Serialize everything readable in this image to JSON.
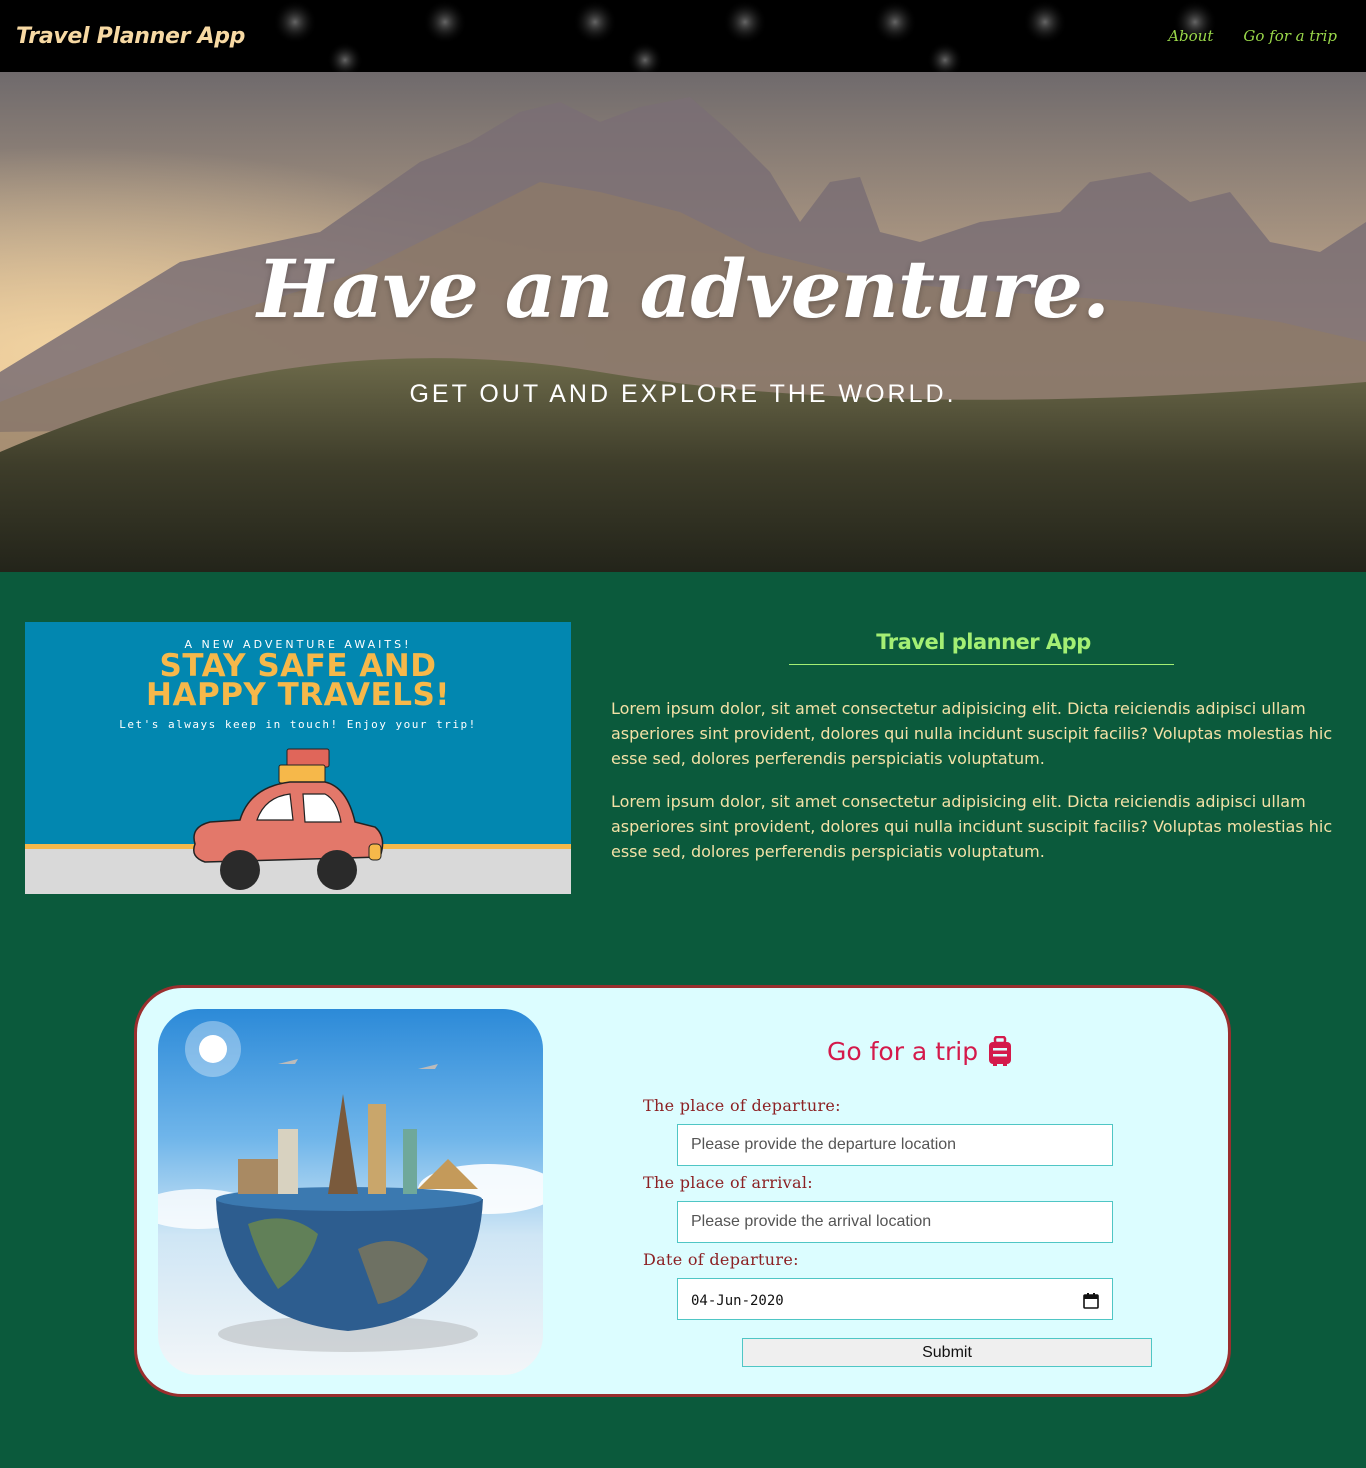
{
  "nav": {
    "brand": "Travel Planner App",
    "links": [
      "About",
      "Go for a trip"
    ]
  },
  "hero": {
    "title": "Have an adventure.",
    "subtitle": "GET OUT AND EXPLORE THE WORLD."
  },
  "about": {
    "image": {
      "kicker": "A NEW ADVENTURE AWAITS!",
      "headline_1": "STAY SAFE AND",
      "headline_2": "HAPPY TRAVELS!",
      "tagline": "Let's always keep in touch! Enjoy your trip!"
    },
    "title": "Travel planner App",
    "paragraphs": [
      "Lorem ipsum dolor, sit amet consectetur adipisicing elit. Dicta reiciendis adipisci ullam asperiores sint provident, dolores qui nulla incidunt suscipit facilis? Voluptas molestias hic esse sed, dolores perferendis perspiciatis voluptatum.",
      "Lorem ipsum dolor, sit amet consectetur adipisicing elit. Dicta reiciendis adipisci ullam asperiores sint provident, dolores qui nulla incidunt suscipit facilis? Voluptas molestias hic esse sed, dolores perferendis perspiciatis voluptatum."
    ]
  },
  "trip": {
    "title": "Go for a trip",
    "title_icon": "suitcase-icon",
    "departure_label": "The place of departure:",
    "departure_placeholder": "Please provide the departure location",
    "arrival_label": "The place of arrival:",
    "arrival_placeholder": "Please provide the arrival location",
    "date_label": "Date of departure:",
    "date_value": "04-Jun-2020",
    "submit_label": "Submit"
  },
  "colors": {
    "nav_bg": "#000000",
    "brand": "#f7d9a3",
    "nav_link": "#9ad84a",
    "page_bg": "#0b5a3c",
    "about_title": "#a4ef74",
    "about_text": "#f3e1a6",
    "card_bg": "#dcfdff",
    "card_border": "#9a2e2e",
    "trip_title": "#d41a4b",
    "form_label": "#8c2124",
    "field_border": "#4fc6c5"
  }
}
